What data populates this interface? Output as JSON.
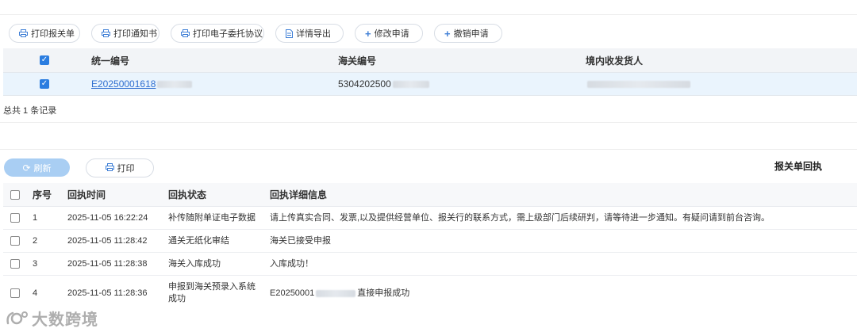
{
  "toolbar": {
    "buttons": [
      {
        "label": "打印报关单",
        "icon": "printer-icon"
      },
      {
        "label": "打印通知书",
        "icon": "printer-icon"
      },
      {
        "label": "打印电子委托协议",
        "icon": "printer-icon"
      },
      {
        "label": "详情导出",
        "icon": "document-icon"
      },
      {
        "label": "修改申请",
        "icon": "plus-icon"
      },
      {
        "label": "撤销申请",
        "icon": "plus-icon"
      }
    ]
  },
  "upper_table": {
    "headers": [
      "统一编号",
      "海关编号",
      "境内收发货人"
    ],
    "rows": [
      {
        "checked": true,
        "unified_no": "E20250001618",
        "customs_no": "5304202500",
        "consignee": ""
      }
    ],
    "total_text": "总共 1 条记录"
  },
  "lower_actions": {
    "refresh_label": "刷新",
    "print_label": "打印",
    "panel_title": "报关单回执"
  },
  "lower_table": {
    "headers": [
      "序号",
      "回执时间",
      "回执状态",
      "回执详细信息"
    ],
    "rows": [
      {
        "no": "1",
        "time": "2025-11-05 16:22:24",
        "status": "补传随附单证电子数据",
        "detail": "请上传真实合同、发票,以及提供经营单位、报关行的联系方式，需上级部门后续研判，请等待进一步通知。有疑问请到前台咨询。"
      },
      {
        "no": "2",
        "time": "2025-11-05 11:28:42",
        "status": "通关无纸化审结",
        "detail": "海关已接受申报"
      },
      {
        "no": "3",
        "time": "2025-11-05 11:28:38",
        "status": "海关入库成功",
        "detail": "入库成功！"
      },
      {
        "no": "4",
        "time": "2025-11-05 11:28:36",
        "status": "申报到海关预录入系统成功",
        "detail_prefix": "E20250001",
        "detail_suffix": "直接申报成功"
      }
    ]
  },
  "watermark": {
    "text": "大数跨境"
  }
}
